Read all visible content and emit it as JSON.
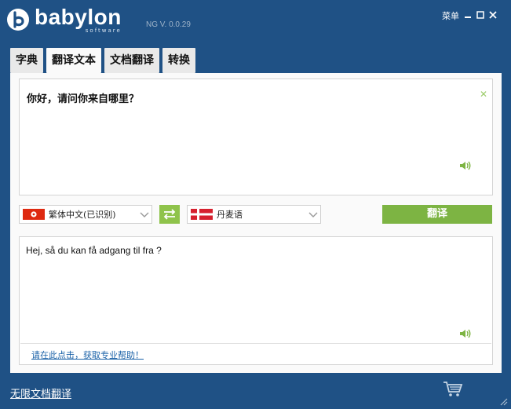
{
  "app": {
    "brand": "babylon",
    "brand_sub": "software",
    "version": "NG V. 0.0.29"
  },
  "window_controls": {
    "menu_label": "菜单"
  },
  "tabs": [
    {
      "label": "字典",
      "active": false
    },
    {
      "label": "翻译文本",
      "active": true
    },
    {
      "label": "文档翻译",
      "active": false
    },
    {
      "label": "转换",
      "active": false
    }
  ],
  "source": {
    "text": "你好，请问你来自哪里？",
    "language": "繁体中文(已识别)",
    "flag": "hong-kong-flag-icon"
  },
  "target": {
    "text": "Hej, så du kan få adgang til fra ?",
    "language": "丹麦语",
    "flag": "denmark-flag-icon",
    "help_link": "请在此点击，获取专业帮助！"
  },
  "translate_button": "翻译",
  "footer": {
    "link": "无限文档翻译"
  },
  "colors": {
    "background": "#1f5185",
    "accent_green": "#7db443",
    "link_blue": "#1b62a8"
  }
}
